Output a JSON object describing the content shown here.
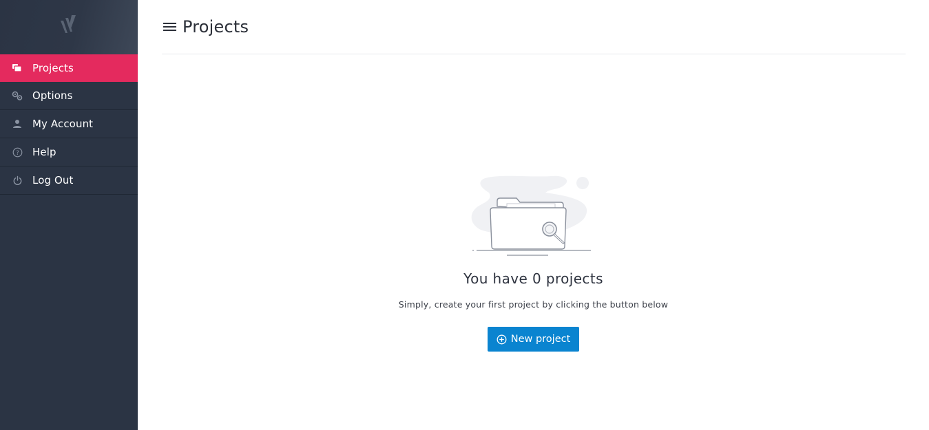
{
  "sidebar": {
    "logo_icon": "brand-logo-icon",
    "items": [
      {
        "label": "Projects",
        "icon": "projects-icon",
        "active": true
      },
      {
        "label": "Options",
        "icon": "gears-icon",
        "active": false
      },
      {
        "label": "My Account",
        "icon": "user-icon",
        "active": false
      },
      {
        "label": "Help",
        "icon": "question-circle-icon",
        "active": false
      },
      {
        "label": "Log Out",
        "icon": "power-icon",
        "active": false
      }
    ]
  },
  "header": {
    "menu_icon": "hamburger-menu-icon",
    "title": "Projects"
  },
  "empty_state": {
    "illustration": "empty-folder-search-icon",
    "title": "You have 0 projects",
    "subtitle": "Simply, create your first project by clicking the button below",
    "button_label": "New project",
    "button_icon": "plus-circle-icon"
  },
  "colors": {
    "sidebar_bg": "#2b3444",
    "active_item": "#e42a5e",
    "primary_button": "#0a84d0"
  }
}
